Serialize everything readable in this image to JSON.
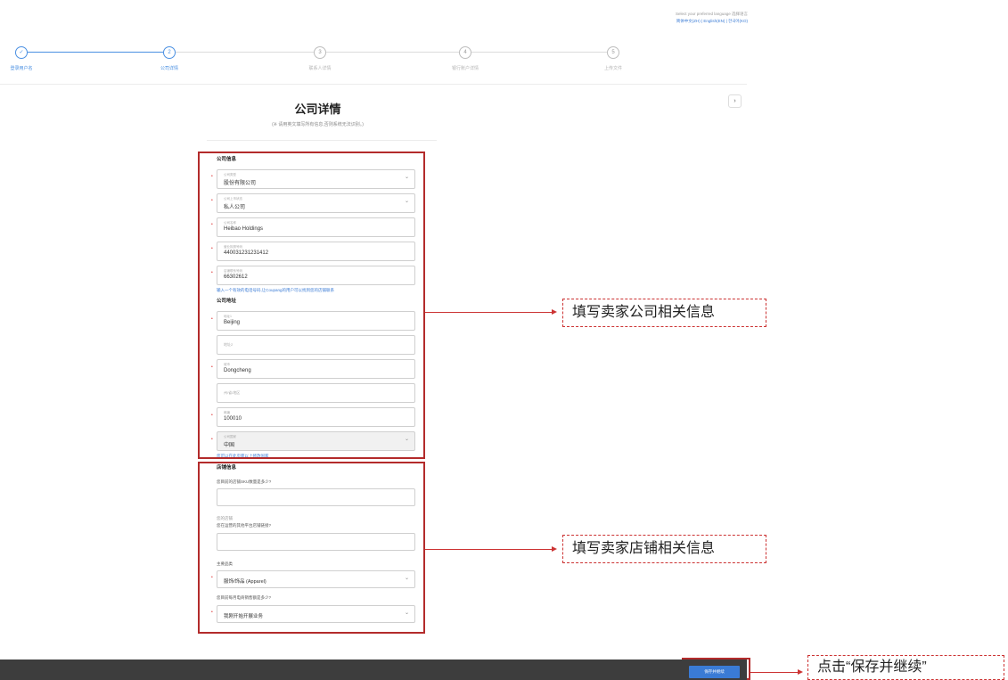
{
  "language": {
    "prompt": "Select your preferred language 选择语言",
    "options": "简体中文(ZH) | English(EN) | 한국어(KO)"
  },
  "steps": [
    {
      "num": "✓",
      "label": "登录用户名",
      "state": "done"
    },
    {
      "num": "2",
      "label": "公司详情",
      "state": "active"
    },
    {
      "num": "3",
      "label": "联系人详情",
      "state": "todo"
    },
    {
      "num": "4",
      "label": "银行账户详情",
      "state": "todo"
    },
    {
      "num": "5",
      "label": "上传文件",
      "state": "todo"
    }
  ],
  "next_icon": "›",
  "page": {
    "title": "公司详情",
    "subtitle": "(※ 请用英文填写所有信息,否则系统无法识别。)"
  },
  "company_info": {
    "heading": "公司信息",
    "fields": [
      {
        "label": "公司类型",
        "value": "股份有限公司",
        "type": "select"
      },
      {
        "label": "公司上市状态",
        "value": "私人公司",
        "type": "select"
      },
      {
        "label": "公司名称",
        "value": "Heibao Holdings",
        "type": "text"
      },
      {
        "label": "营业执照号码",
        "value": "440031231231412",
        "type": "text"
      },
      {
        "label": "店铺联系号码",
        "value": "66302612",
        "type": "text"
      }
    ],
    "phone_hint": "输入一个有效的电话号码,让Coupang的用户可以找到您的店铺联系"
  },
  "company_address": {
    "heading": "公司地址",
    "fields": [
      {
        "label": "地址1",
        "value": "Beijing",
        "required": true
      },
      {
        "label": "地址2",
        "value": "",
        "required": false
      },
      {
        "label": "城市",
        "value": "Dongcheng",
        "required": true
      },
      {
        "label": "州/省/地区",
        "value": "",
        "required": false
      },
      {
        "label": "邮编",
        "value": "100010",
        "required": true
      },
      {
        "label": "公司国家",
        "value": "中国",
        "required": true,
        "type": "select",
        "disabled": true
      }
    ],
    "country_hint": "您可以在此页面以上修改国家"
  },
  "store_info": {
    "heading": "店铺信息",
    "q_sku": "您目前的店铺SKU数量是多少?",
    "store_link_label": "您的店铺",
    "q_store_link": "您在运营的其他平台店铺链接?",
    "main_category_label": "主要品类",
    "main_category_value": "服饰/饰品 (Apparel)",
    "q_sales": "您目前每月电商销售额是多少?",
    "sales_value": "我刚开始开展业务"
  },
  "callouts": {
    "company": "填写卖家公司相关信息",
    "store": "填写卖家店铺相关信息",
    "save": "点击“保存并继续”"
  },
  "footer": {
    "save_button": "保存并继续"
  },
  "icons": {
    "chevron": "⌄",
    "required": "•"
  },
  "colors": {
    "accent": "#3a7bd5",
    "annotation": "#b32b2b",
    "footer": "#3d3d3d"
  }
}
